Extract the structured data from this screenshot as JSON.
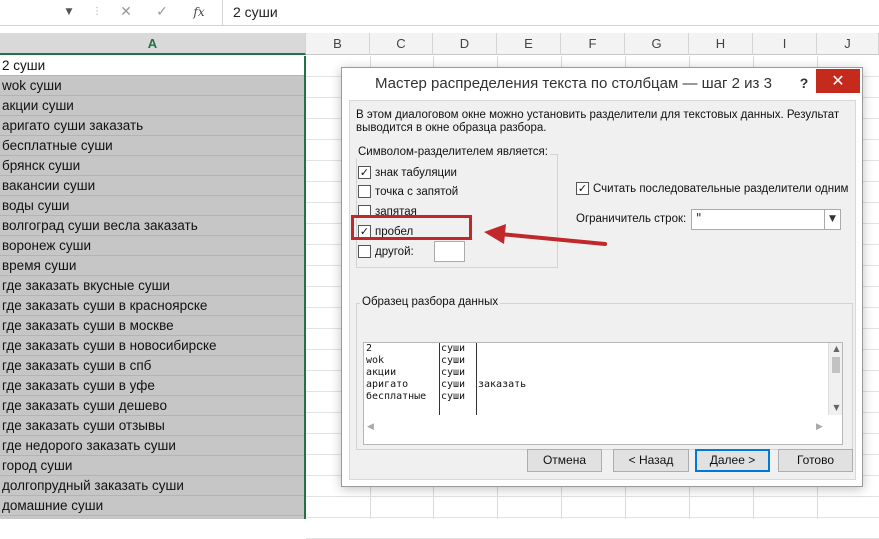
{
  "formula_bar": {
    "formula_value": "2 суши",
    "cancel_icon": "cancel-icon",
    "confirm_icon": "confirm-icon",
    "fx_label": "fx"
  },
  "columns": [
    "A",
    "B",
    "C",
    "D",
    "E",
    "F",
    "G",
    "H",
    "I",
    "J"
  ],
  "selected_column": "A",
  "column_a_cells": [
    "2 суши",
    "wok суши",
    "акции суши",
    "аригато суши заказать",
    "бесплатные суши",
    "брянск суши",
    "вакансии суши",
    "воды суши",
    "волгоград суши весла заказать",
    "воронеж суши",
    "время суши",
    "где заказать вкусные суши",
    "где заказать суши в красноярске",
    "где заказать суши в москве",
    "где заказать суши в новосибирске",
    "где заказать суши в спб",
    "где заказать суши в уфе",
    "где заказать суши дешево",
    "где заказать суши отзывы",
    "где недорого заказать суши",
    "город суши",
    "долгопрудный заказать суши",
    "домашние суши"
  ],
  "dialog": {
    "title": "Мастер распределения текста по столбцам — шаг 2 из 3",
    "help": "?",
    "close": "✕",
    "description": "В этом диалоговом окне можно установить разделители для текстовых данных. Результат выводится в окне образца разбора.",
    "delimiters_title": "Символом-разделителем является:",
    "delimiters": [
      {
        "label": "знак табуляции",
        "checked": true
      },
      {
        "label": "точка с запятой",
        "checked": false
      },
      {
        "label": "запятая",
        "checked": false
      },
      {
        "label": "пробел",
        "checked": true
      },
      {
        "label": "другой:",
        "checked": false
      }
    ],
    "consecutive_label": "Считать последовательные разделители одним",
    "consecutive_checked": true,
    "qualifier_label": "Ограничитель строк:",
    "qualifier_value": "\"",
    "preview_title": "Образец разбора данных",
    "preview_rows": [
      [
        "2",
        "суши",
        ""
      ],
      [
        "wok",
        "суши",
        ""
      ],
      [
        "акции",
        "суши",
        ""
      ],
      [
        "аригато",
        "суши",
        "заказать"
      ],
      [
        "бесплатные",
        "суши",
        ""
      ]
    ],
    "buttons": {
      "cancel": "Отмена",
      "back": "< Назад",
      "next": "Далее >",
      "finish": "Готово"
    }
  },
  "annotation": {
    "highlight_color": "#c0282c"
  }
}
